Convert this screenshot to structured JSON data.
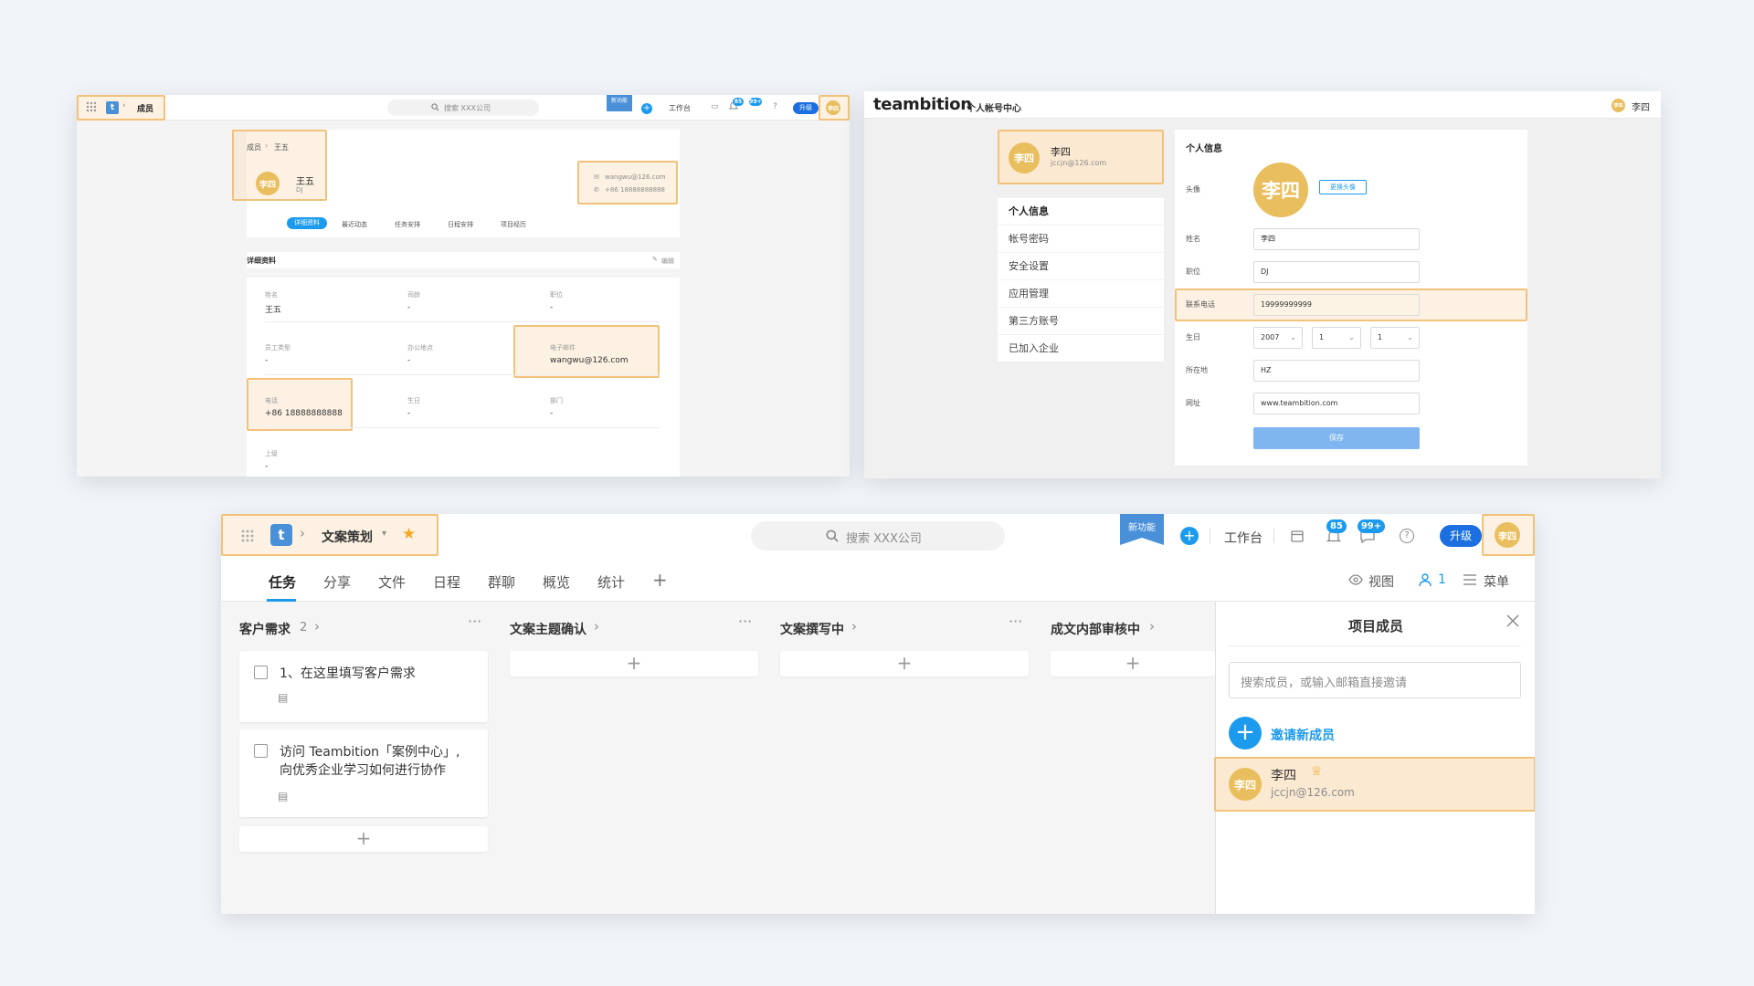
{
  "window1": {
    "breadcrumb_members": "成员",
    "search_placeholder": "搜索 XXX公司",
    "new_feature": "新功能",
    "workbench": "工作台",
    "badge_notif": "85",
    "badge_msg": "99+",
    "upgrade": "升级",
    "avatar": "李四",
    "path_parent": "成员",
    "path_current": "王五",
    "user_avatar": "李四",
    "user_name": "王五",
    "user_title": "DJ",
    "contact_email": "wangwu@126.com",
    "contact_phone": "+86 18888888888",
    "tabs": [
      "详细资料",
      "最近动态",
      "任务安排",
      "日程安排",
      "项目经历"
    ],
    "section_title": "详细资料",
    "edit": "编辑",
    "fields": [
      {
        "label": "姓名",
        "value": "王五"
      },
      {
        "label": "司龄",
        "value": "-"
      },
      {
        "label": "职位",
        "value": "-"
      },
      {
        "label": "员工类型",
        "value": "-"
      },
      {
        "label": "办公地点",
        "value": "-"
      },
      {
        "label": "电子邮件",
        "value": "wangwu@126.com"
      },
      {
        "label": "电话",
        "value": "+86 18888888888"
      },
      {
        "label": "生日",
        "value": "-"
      },
      {
        "label": "部门",
        "value": "-"
      },
      {
        "label": "上级",
        "value": "-"
      }
    ]
  },
  "window2": {
    "brand": "teambition",
    "subtitle": "个人帐号中心",
    "top_avatar": "李四",
    "top_user": "李四",
    "profile_avatar": "李四",
    "profile_name": "李四",
    "profile_email": "jccjn@126.com",
    "menu": [
      "个人信息",
      "帐号密码",
      "安全设置",
      "应用管理",
      "第三方账号",
      "已加入企业"
    ],
    "form_title": "个人信息",
    "label_avatar": "头像",
    "big_avatar": "李四",
    "change_avatar": "更换头像",
    "label_name": "姓名",
    "value_name": "李四",
    "label_title": "职位",
    "value_title": "DJ",
    "label_phone": "联系电话",
    "value_phone": "19999999999",
    "label_birthday": "生日",
    "birthday": [
      "2007",
      "1",
      "1"
    ],
    "label_location": "所在地",
    "value_location": "HZ",
    "label_website": "网址",
    "value_website": "www.teambition.com",
    "save": "保存"
  },
  "window3": {
    "project_name": "文案策划",
    "search_placeholder": "搜索 XXX公司",
    "new_feature": "新功能",
    "workbench": "工作台",
    "badge_notif": "85",
    "badge_msg": "99+",
    "upgrade": "升级",
    "avatar": "李四",
    "tabs": [
      "任务",
      "分享",
      "文件",
      "日程",
      "群聊",
      "概览",
      "统计"
    ],
    "view": "视图",
    "member_count": "1",
    "menu": "菜单",
    "columns": [
      {
        "title": "客户需求",
        "count": "2"
      },
      {
        "title": "文案主题确认"
      },
      {
        "title": "文案撰写中"
      },
      {
        "title": "成文内部审核中"
      }
    ],
    "task1": "1、在这里填写客户需求",
    "task2_line1": "访问 Teambition「案例中心」,",
    "task2_line2": "向优秀企业学习如何进行协作",
    "panel_title": "项目成员",
    "panel_search_placeholder": "搜索成员，或输入邮箱直接邀请",
    "invite": "邀请新成员",
    "member_avatar": "李四",
    "member_name": "李四",
    "member_email": "jccjn@126.com"
  },
  "colors": {
    "accent": "#1b9aee",
    "highlight_border": "#f2c27a",
    "highlight_fill": "#f8e0be",
    "avatar": "#e9be5e",
    "star": "#f5a623"
  }
}
